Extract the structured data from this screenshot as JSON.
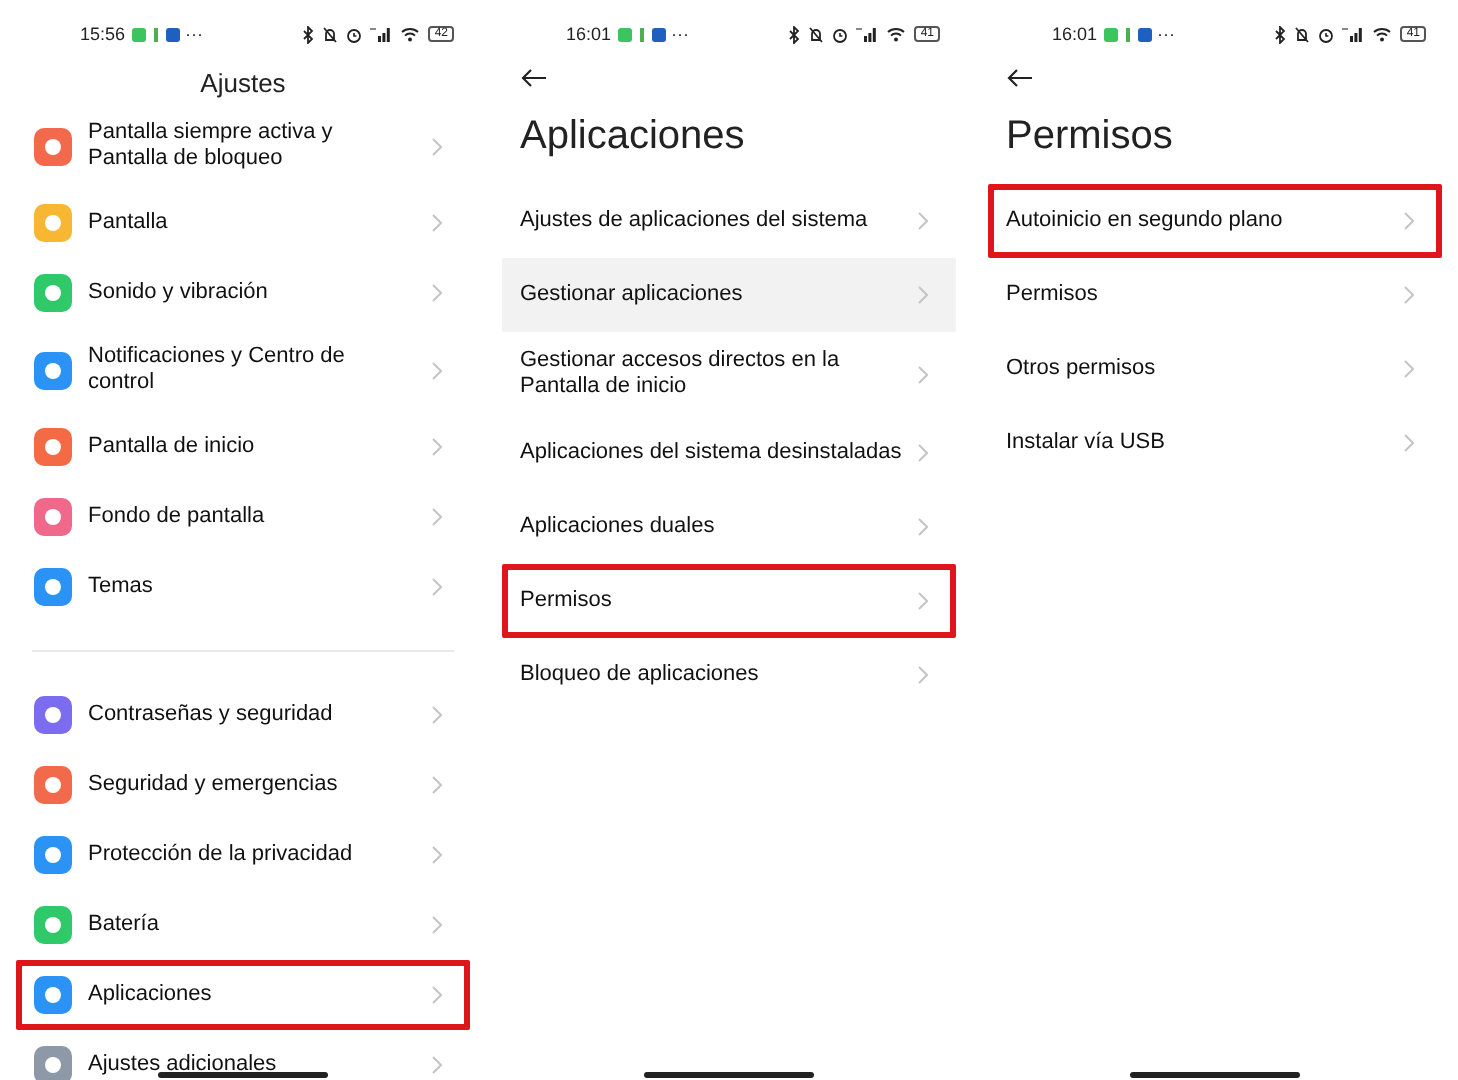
{
  "screens": [
    {
      "kind": "main",
      "status_bar": {
        "time": "15:56",
        "more": "···",
        "battery": "42"
      },
      "title": "Ajustes",
      "groups": [
        {
          "items": [
            {
              "label": "Pantalla siempre activa y Pantalla de bloqueo",
              "color": "#f26a4b",
              "highlighted": false,
              "pressed": false
            },
            {
              "label": "Pantalla",
              "color": "#f7b733",
              "highlighted": false,
              "pressed": false
            },
            {
              "label": "Sonido y vibración",
              "color": "#2fc96a",
              "highlighted": false,
              "pressed": false
            },
            {
              "label": "Notificaciones y Centro de control",
              "color": "#2a93f5",
              "highlighted": false,
              "pressed": false
            },
            {
              "label": "Pantalla de inicio",
              "color": "#f46a45",
              "highlighted": false,
              "pressed": false
            },
            {
              "label": "Fondo de pantalla",
              "color": "#f0688a",
              "highlighted": false,
              "pressed": false
            },
            {
              "label": "Temas",
              "color": "#2a93f5",
              "highlighted": false,
              "pressed": false
            }
          ]
        },
        {
          "items": [
            {
              "label": "Contraseñas y seguridad",
              "color": "#7b6cf0",
              "highlighted": false,
              "pressed": false
            },
            {
              "label": "Seguridad y emergencias",
              "color": "#f26a4b",
              "highlighted": false,
              "pressed": false
            },
            {
              "label": "Protección de la privacidad",
              "color": "#2a93f5",
              "highlighted": false,
              "pressed": false
            },
            {
              "label": "Batería",
              "color": "#2fc96a",
              "highlighted": false,
              "pressed": false
            },
            {
              "label": "Aplicaciones",
              "color": "#2a93f5",
              "highlighted": true,
              "pressed": false
            },
            {
              "label": "Ajustes adicionales",
              "color": "#8e99a8",
              "highlighted": false,
              "pressed": false
            }
          ]
        }
      ]
    },
    {
      "kind": "sub",
      "status_bar": {
        "time": "16:01",
        "more": "···",
        "battery": "41"
      },
      "title": "Aplicaciones",
      "groups": [
        {
          "items": [
            {
              "label": "Ajustes de aplicaciones del sistema",
              "highlighted": false,
              "pressed": false
            },
            {
              "label": "Gestionar aplicaciones",
              "highlighted": false,
              "pressed": true
            },
            {
              "label": "Gestionar accesos directos en la Pantalla de inicio",
              "highlighted": false,
              "pressed": false
            },
            {
              "label": "Aplicaciones del sistema desinstaladas",
              "highlighted": false,
              "pressed": false
            },
            {
              "label": "Aplicaciones duales",
              "highlighted": false,
              "pressed": false
            },
            {
              "label": "Permisos",
              "highlighted": true,
              "pressed": false
            },
            {
              "label": "Bloqueo de aplicaciones",
              "highlighted": false,
              "pressed": false
            }
          ]
        }
      ]
    },
    {
      "kind": "sub",
      "status_bar": {
        "time": "16:01",
        "more": "···",
        "battery": "41"
      },
      "title": "Permisos",
      "groups": [
        {
          "items": [
            {
              "label": "Autoinicio en segundo plano",
              "highlighted": true,
              "pressed": false
            },
            {
              "label": "Permisos",
              "highlighted": false,
              "pressed": false
            },
            {
              "label": "Otros permisos",
              "highlighted": false,
              "pressed": false
            },
            {
              "label": "Instalar vía USB",
              "highlighted": false,
              "pressed": false
            }
          ]
        }
      ]
    }
  ]
}
